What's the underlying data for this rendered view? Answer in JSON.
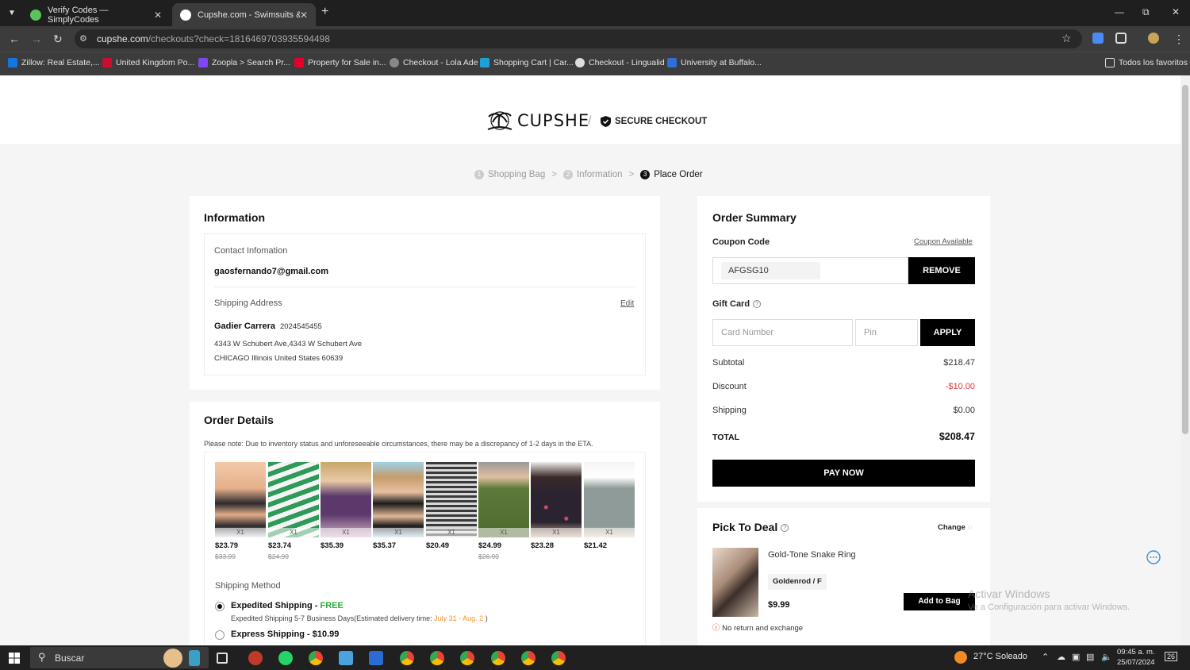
{
  "browser": {
    "tabs": [
      {
        "label": "Verify Codes — SimplyCodes",
        "color": "#5cc25c"
      },
      {
        "label": "Cupshe.com - Swimsuits & Fast",
        "color": "#ffffff"
      }
    ],
    "new_tab": "+",
    "url_host": "cupshe.com",
    "url_path": "/checkouts?check=1816469703935594498",
    "bookmarks": [
      {
        "label": "Zillow: Real Estate,...",
        "color": "#1277e1"
      },
      {
        "label": "United Kingdom Po...",
        "color": "#c8102e"
      },
      {
        "label": "Zoopla > Search Pr...",
        "color": "#8046f1"
      },
      {
        "label": "Property for Sale in...",
        "color": "#e4002b"
      },
      {
        "label": "Checkout - Lola Ade",
        "color": "#888888"
      },
      {
        "label": "Shopping Cart | Car...",
        "color": "#1ea0d6"
      },
      {
        "label": "Checkout - Lingualid",
        "color": "#dddddd"
      },
      {
        "label": "University at Buffalo...",
        "color": "#2f6fd6"
      }
    ],
    "all_bookmarks": "Todos los favoritos"
  },
  "header": {
    "brand": "CUPSHE",
    "separator": "/",
    "secure": "SECURE CHECKOUT"
  },
  "steps": [
    {
      "num": "1",
      "label": "Shopping Bag"
    },
    {
      "num": "2",
      "label": "Information"
    },
    {
      "num": "3",
      "label": "Place Order"
    }
  ],
  "information": {
    "title": "Information",
    "contact_label": "Contact Infomation",
    "email": "gaosfernando7@gmail.com",
    "shipping_label": "Shipping Address",
    "edit": "Edit",
    "name": "Gadier Carrera",
    "phone": "2024545455",
    "address1": "4343 W Schubert Ave,4343 W Schubert Ave",
    "address2": "CHICAGO Illinois United States 60639"
  },
  "order_details": {
    "title": "Order Details",
    "note": "Please note: Due to inventory status and unforeseeable circumstances, there may be a discrepancy of 1-2 days in the ETA.",
    "products": [
      {
        "qty": "X1",
        "price": "$23.79",
        "old": "$33.99",
        "color": "#2d2a2e"
      },
      {
        "qty": "X1",
        "price": "$23.74",
        "old": "$24.99",
        "color": "#2e9a58"
      },
      {
        "qty": "X1",
        "price": "$35.39",
        "old": "",
        "color": "#5b3a6b"
      },
      {
        "qty": "X1",
        "price": "$35.37",
        "old": "",
        "color": "#1b1b1b"
      },
      {
        "qty": "X1",
        "price": "$20.49",
        "old": "",
        "color": "#6e6e6e"
      },
      {
        "qty": "X1",
        "price": "$24.99",
        "old": "$26.99",
        "color": "#5d7a3a"
      },
      {
        "qty": "X1",
        "price": "$23.28",
        "old": "",
        "color": "#2b2430"
      },
      {
        "qty": "X1",
        "price": "$21.42",
        "old": "",
        "color": "#8e9b98"
      }
    ],
    "shipping_method_label": "Shipping Method",
    "expedited": "Expedited Shipping",
    "dash": "-",
    "free": "FREE",
    "expedited_desc": "Expedited Shipping 5-7 Business Days(Estimated delivery time:",
    "expedited_date": "July 31 - Aug. 2",
    "close_paren": ")",
    "express": "Express Shipping",
    "express_price": "$10.99"
  },
  "summary": {
    "title": "Order Summary",
    "coupon_label": "Coupon Code",
    "coupon_available": "Coupon Available",
    "coupon_code": "AFGSG10",
    "remove": "REMOVE",
    "gift_label": "Gift Card",
    "card_placeholder": "Card Number",
    "pin_placeholder": "Pin",
    "apply": "APPLY",
    "subtotal_label": "Subtotal",
    "subtotal": "$218.47",
    "discount_label": "Discount",
    "discount": "-$10.00",
    "shipping_label": "Shipping",
    "shipping": "$0.00",
    "total_label": "TOTAL",
    "total": "$208.47",
    "pay": "PAY NOW"
  },
  "deal": {
    "title": "Pick To Deal",
    "change": "Change",
    "name": "Gold-Tone Snake Ring",
    "variant": "Goldenrod / F",
    "price": "$9.99",
    "add": "Add to Bag",
    "no_return": "No return and exchange"
  },
  "watermark": {
    "line1": "Activar Windows",
    "line2": "Ve a Configuración para activar Windows."
  },
  "taskbar": {
    "search": "Buscar",
    "weather": "27°C  Soleado",
    "time": "09:45 a. m.",
    "date": "25/07/2024",
    "notif": "26"
  },
  "colors": {
    "accent": "#000000",
    "discount": "#e53935",
    "free": "#2cae3c",
    "eta": "#f0932b"
  }
}
